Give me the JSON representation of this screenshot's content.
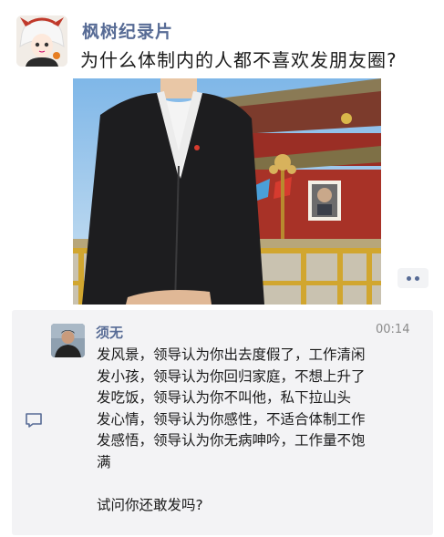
{
  "post": {
    "author": "枫树纪录片",
    "text": "为什么体制内的人都不喜欢发朋友圈?",
    "more_icon": "ellipsis-icon"
  },
  "comment": {
    "name": "须无",
    "time": "00:14",
    "lines": [
      "发风景，领导认为你出去度假了，工作清闲",
      "发小孩，领导认为你回归家庭，不想上升了",
      "发吃饭，领导认为你不叫他，私下拉山头",
      "发心情，领导认为你感性，不适合体制工作",
      "发感悟，领导认为你无病呻吟，工作量不饱",
      "满"
    ],
    "question": "试问你还敢发吗?",
    "comment_icon": "comment-bubble-icon"
  },
  "colors": {
    "link": "#576b95",
    "comment_bg": "#f3f3f5",
    "text": "#1a1a1a"
  }
}
